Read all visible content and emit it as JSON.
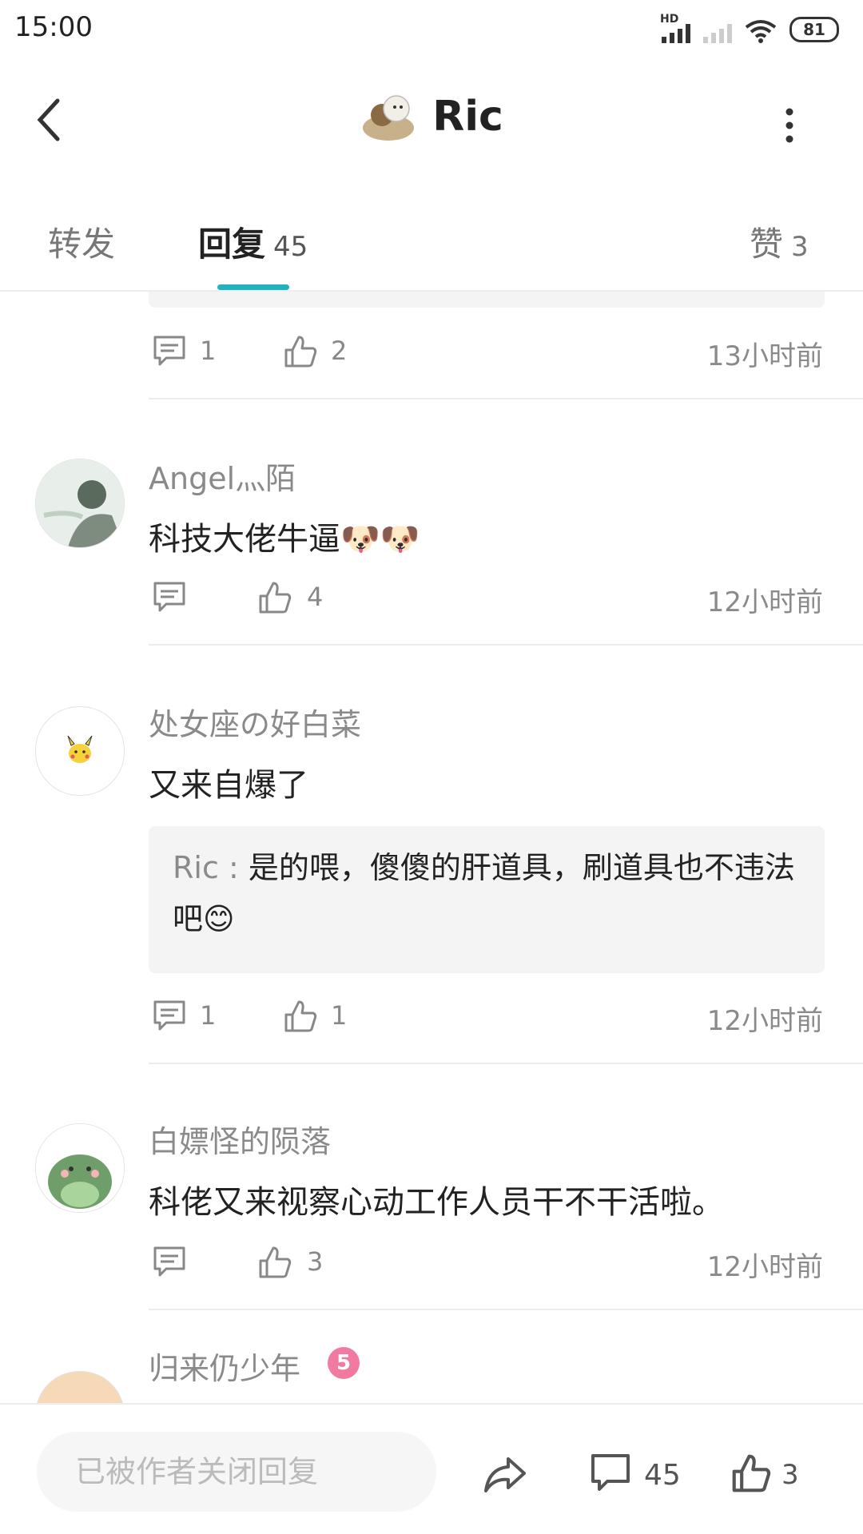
{
  "status_bar": {
    "time": "15:00",
    "network": "HD",
    "battery": "81"
  },
  "header": {
    "title": "Ric",
    "back_icon": "chevron-left-icon",
    "menu_icon": "more-vertical-icon"
  },
  "tabs": [
    {
      "label": "转发"
    },
    {
      "label": "回复",
      "count": "45"
    },
    {
      "label": "赞",
      "count": "3"
    }
  ],
  "comments": [
    {
      "reply_count": "1",
      "like_count": "2",
      "time": "13小时前"
    },
    {
      "name": "Angel灬陌",
      "text": "科技大佬牛逼🐶🐶",
      "reply_count": "",
      "like_count": "4",
      "time": "12小时前"
    },
    {
      "name": "处女座の好白菜",
      "text": "又来自爆了",
      "quote_name": "Ric",
      "quote_sep": " : ",
      "quote_text": "是的喂，傻傻的肝道具，刷道具也不违法吧😊",
      "reply_count": "1",
      "like_count": "1",
      "time": "12小时前"
    },
    {
      "name": "白嫖怪的陨落",
      "text": "科佬又来视察心动工作人员干不干活啦。",
      "reply_count": "",
      "like_count": "3",
      "time": "12小时前"
    },
    {
      "name": "归来仍少年",
      "badge": "5"
    }
  ],
  "bottom_bar": {
    "placeholder": "已被作者关闭回复",
    "comment_count": "45",
    "like_count": "3"
  },
  "colors": {
    "accent": "#1fb2c0",
    "muted": "#8a8a8a"
  }
}
